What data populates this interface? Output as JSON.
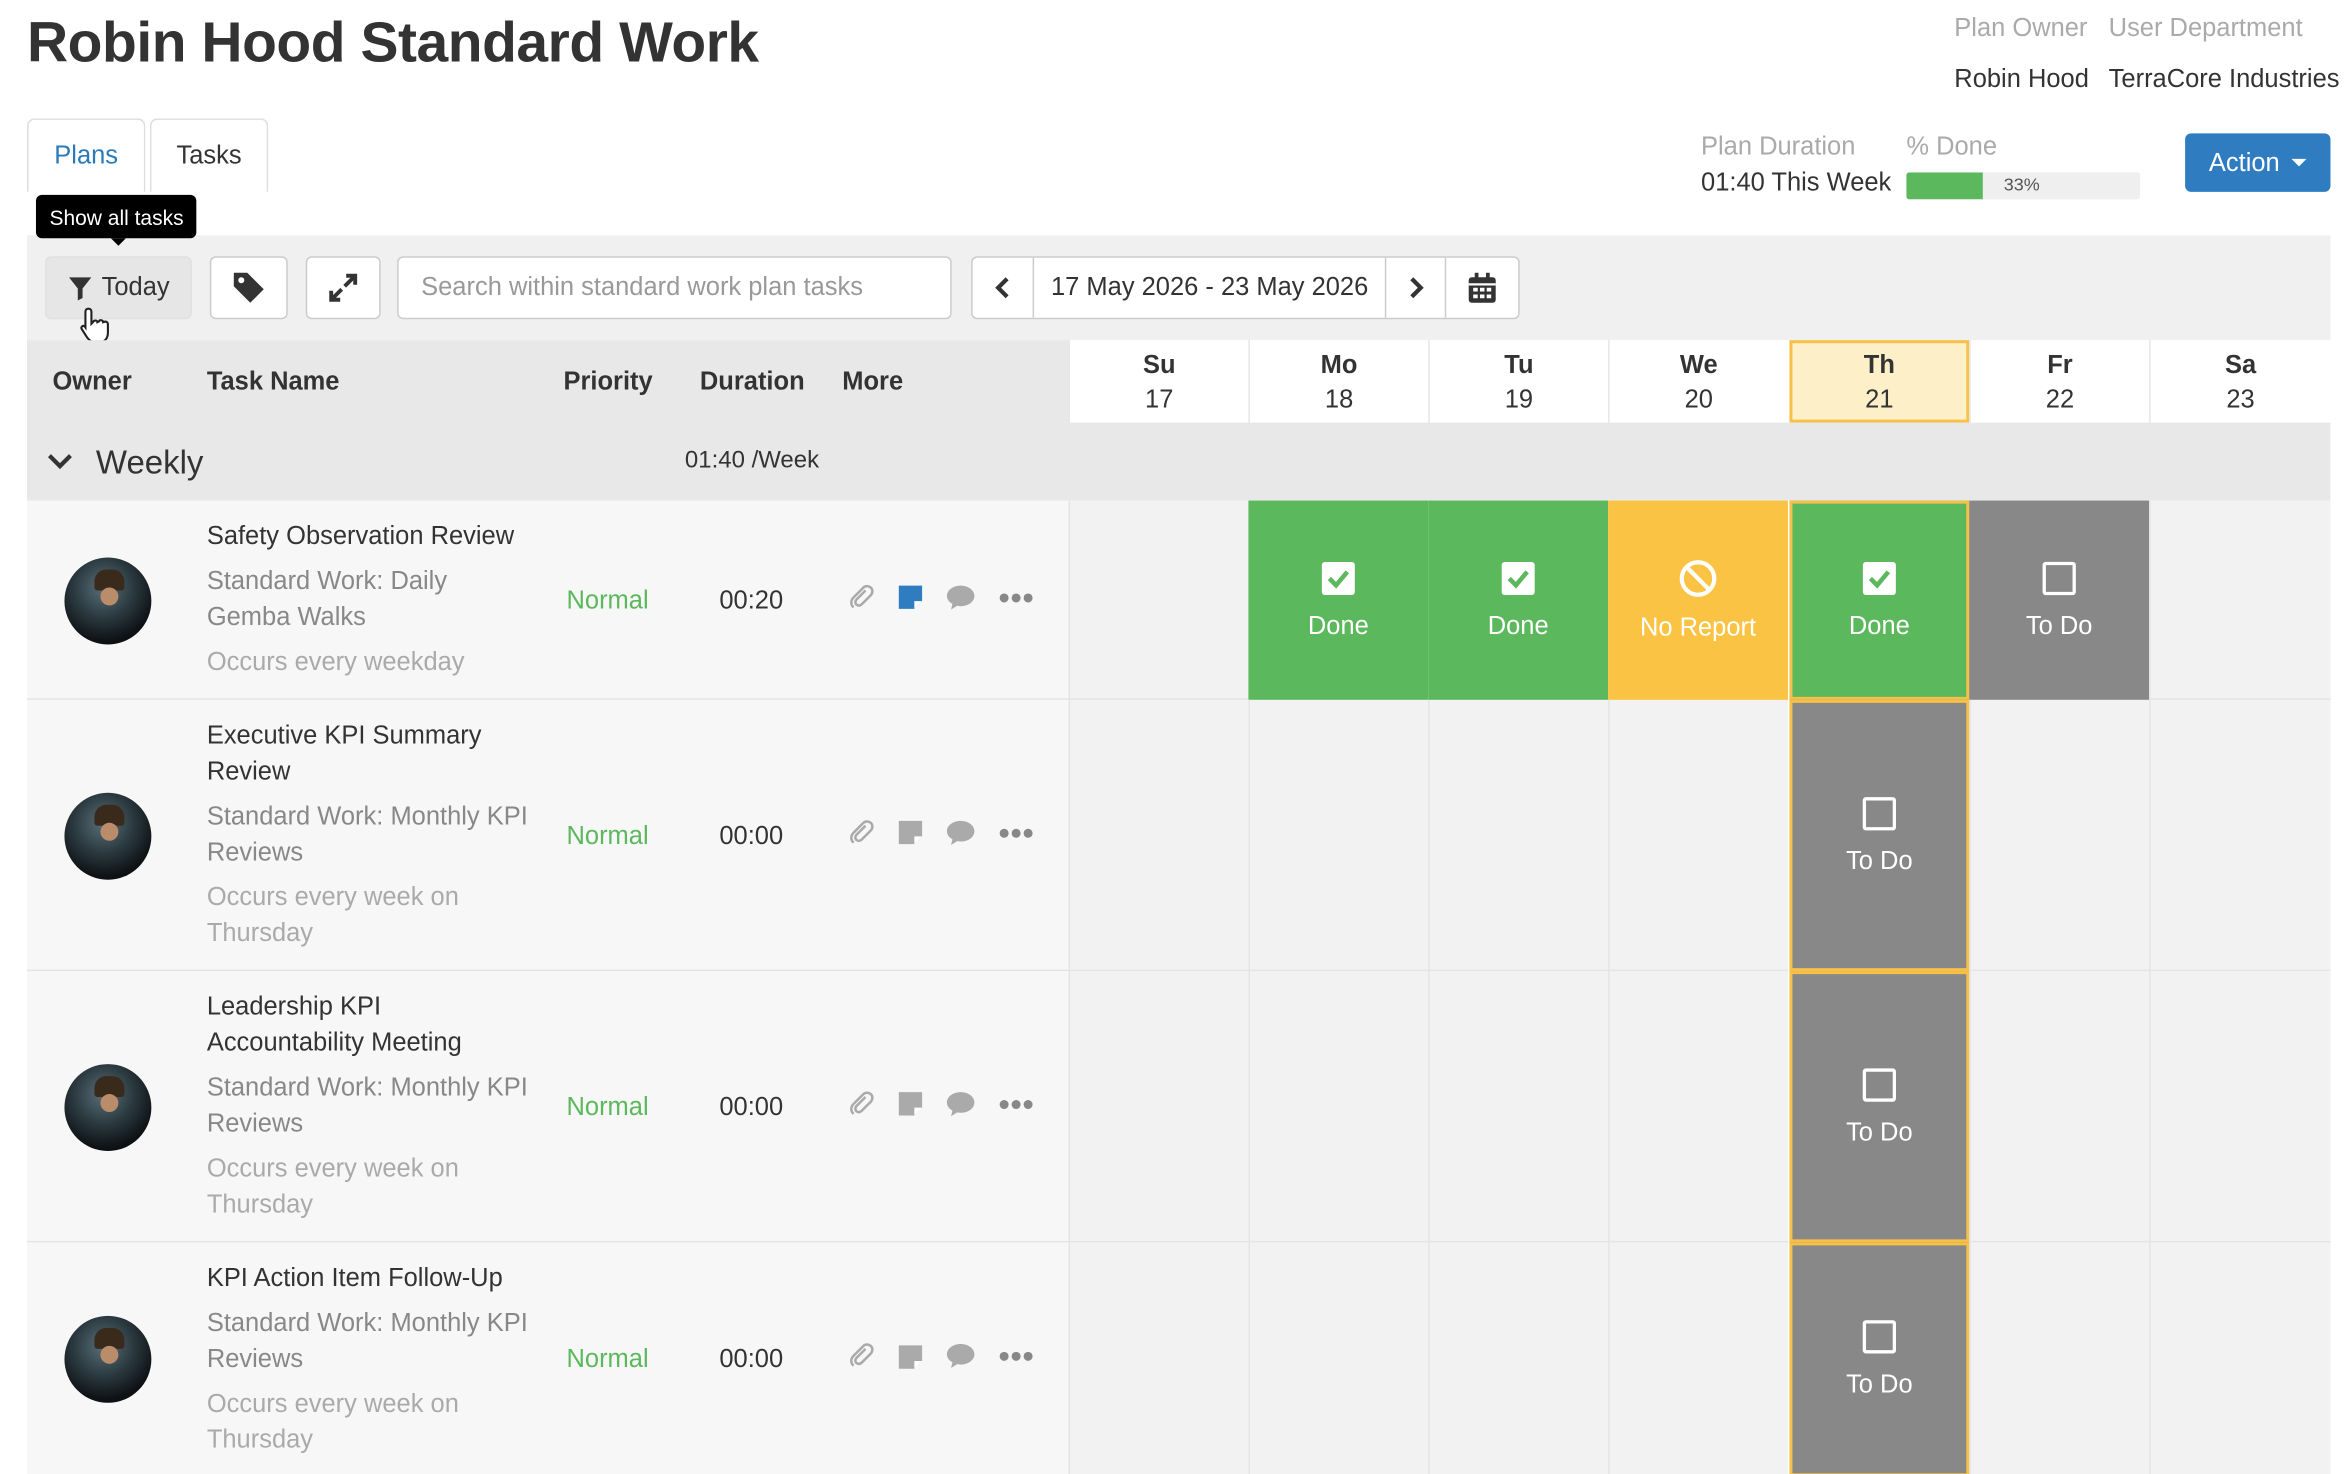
{
  "page": {
    "title": "Robin Hood Standard Work",
    "plan_owner_label": "Plan Owner",
    "plan_owner": "Robin Hood",
    "user_department_label": "User Department",
    "user_department": "TerraCore Industries",
    "plan_duration_label": "Plan Duration",
    "plan_duration": "01:40 This Week",
    "percent_done_label": "% Done",
    "percent_done": 33,
    "percent_done_text": "33%",
    "action_label": "Action"
  },
  "tabs": [
    {
      "label": "Plans",
      "active": false
    },
    {
      "label": "Tasks",
      "active": true
    }
  ],
  "toolbar": {
    "today_label": "Today",
    "tooltip": "Show all tasks",
    "search_placeholder": "Search within standard work plan tasks",
    "date_range": "17 May 2026 - 23 May 2026"
  },
  "columns": {
    "owner": "Owner",
    "task_name": "Task Name",
    "priority": "Priority",
    "duration": "Duration",
    "more": "More"
  },
  "days": [
    {
      "name": "Su",
      "num": "17"
    },
    {
      "name": "Mo",
      "num": "18"
    },
    {
      "name": "Tu",
      "num": "19"
    },
    {
      "name": "We",
      "num": "20"
    },
    {
      "name": "Th",
      "num": "21",
      "today": true
    },
    {
      "name": "Fr",
      "num": "22"
    },
    {
      "name": "Sa",
      "num": "23"
    }
  ],
  "group": {
    "label": "Weekly",
    "duration": "01:40 /Week"
  },
  "tasks": [
    {
      "name": "Safety Observation Review",
      "plan": "Standard Work: Daily Gemba Walks",
      "occurs": "Occurs every weekday",
      "priority": "Normal",
      "duration": "00:20",
      "has_note": true,
      "statuses": [
        "",
        "Done",
        "Done",
        "No Report",
        "Done",
        "To Do",
        ""
      ]
    },
    {
      "name": "Executive KPI Summary Review",
      "plan": "Standard Work: Monthly KPI Reviews",
      "occurs": "Occurs every week on Thursday",
      "priority": "Normal",
      "duration": "00:00",
      "has_note": false,
      "statuses": [
        "",
        "",
        "",
        "",
        "To Do",
        "",
        ""
      ]
    },
    {
      "name": "Leadership KPI Accountability Meeting",
      "plan": "Standard Work: Monthly KPI Reviews",
      "occurs": "Occurs every week on Thursday",
      "priority": "Normal",
      "duration": "00:00",
      "has_note": false,
      "statuses": [
        "",
        "",
        "",
        "",
        "To Do",
        "",
        ""
      ]
    },
    {
      "name": "KPI Action Item Follow-Up",
      "plan": "Standard Work: Monthly KPI Reviews",
      "occurs": "Occurs every week on Thursday",
      "priority": "Normal",
      "duration": "00:00",
      "has_note": false,
      "statuses": [
        "",
        "",
        "",
        "",
        "To Do",
        "",
        ""
      ]
    }
  ],
  "icons": {
    "filter": "filter-icon",
    "tag": "tag-icon",
    "expand": "expand-icon",
    "prev": "chevron-left-icon",
    "next": "chevron-right-icon",
    "calendar": "calendar-icon",
    "collapse": "chevron-down-icon",
    "attachment": "paperclip-icon",
    "note": "note-icon",
    "comment": "comment-icon",
    "more": "ellipsis-icon"
  },
  "colors": {
    "done": "#5cb85c",
    "no_report": "#fbc344",
    "todo": "#888888",
    "accent": "#2f7cc1",
    "today_highlight": "#f7c046"
  }
}
